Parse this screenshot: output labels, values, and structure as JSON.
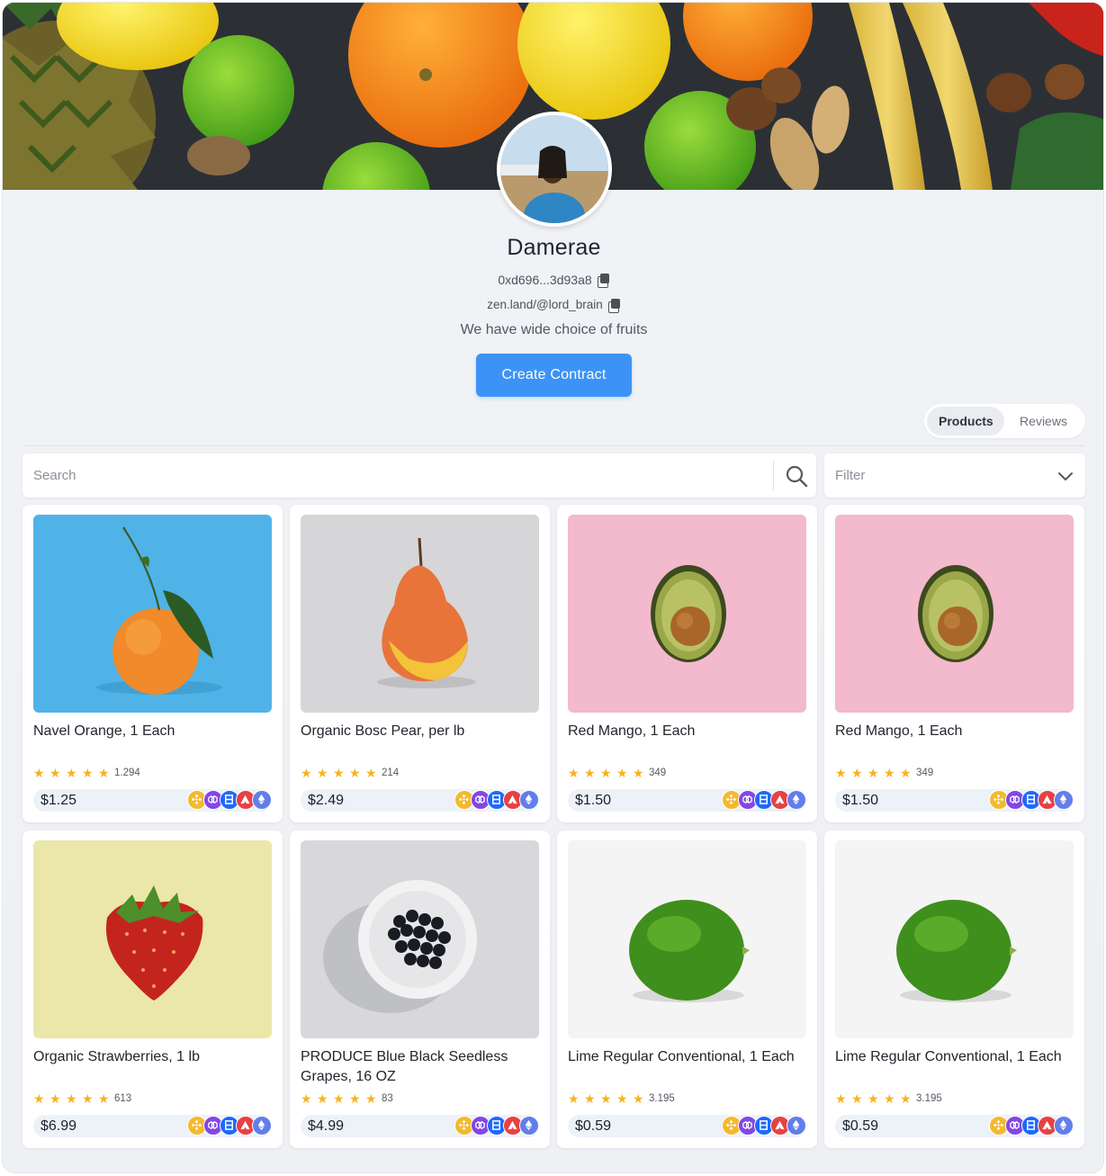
{
  "profile": {
    "name": "Damerae",
    "address": "0xd696...3d93a8",
    "link": "zen.land/@lord_brain",
    "bio": "We have wide choice of fruits",
    "create_label": "Create Contract"
  },
  "tabs": [
    {
      "label": "Products",
      "active": true
    },
    {
      "label": "Reviews",
      "active": false
    }
  ],
  "search": {
    "placeholder": "Search"
  },
  "filter": {
    "label": "Filter"
  },
  "chains": [
    {
      "name": "bnb-icon",
      "color": "#f3ba2f"
    },
    {
      "name": "polygon-icon",
      "color": "#8247e5"
    },
    {
      "name": "zksync-icon",
      "color": "#1e69ff"
    },
    {
      "name": "avalanche-icon",
      "color": "#e84142"
    },
    {
      "name": "ethereum-icon",
      "color": "#627eea"
    }
  ],
  "products": [
    {
      "title": "Navel Orange, 1 Each",
      "rating_count": "1.294",
      "price": "$1.25",
      "image": "orange-image"
    },
    {
      "title": "Organic Bosc Pear, per lb",
      "rating_count": "214",
      "price": "$2.49",
      "image": "pear-image"
    },
    {
      "title": "Red Mango, 1 Each",
      "rating_count": "349",
      "price": "$1.50",
      "image": "avocado-image"
    },
    {
      "title": "Red Mango, 1 Each",
      "rating_count": "349",
      "price": "$1.50",
      "image": "avocado-image"
    },
    {
      "title": "Organic Strawberries, 1 lb",
      "rating_count": "613",
      "price": "$6.99",
      "image": "strawberry-image"
    },
    {
      "title": "PRODUCE Blue Black Seedless Grapes, 16 OZ",
      "rating_count": "83",
      "price": "$4.99",
      "image": "grapes-image"
    },
    {
      "title": "Lime Regular Conventional, 1 Each",
      "rating_count": "3.195",
      "price": "$0.59",
      "image": "lime-image"
    },
    {
      "title": "Lime Regular Conventional, 1 Each",
      "rating_count": "3.195",
      "price": "$0.59",
      "image": "lime-image"
    }
  ]
}
